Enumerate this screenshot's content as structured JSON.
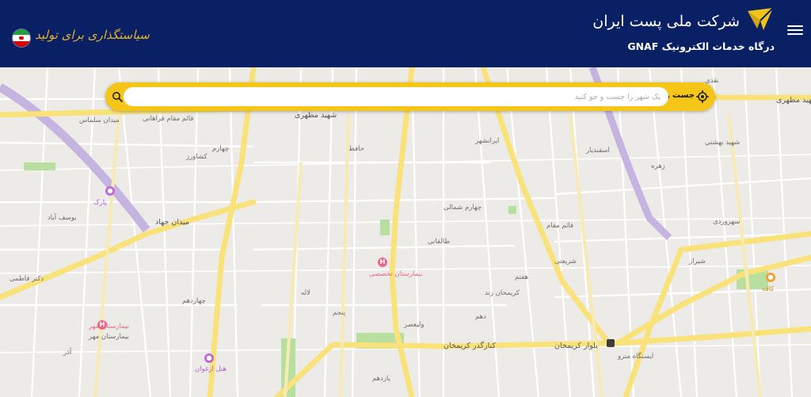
{
  "header": {
    "company_name": "شرکت ملی پست ایران",
    "portal_title": "درگاه خدمات الکترونیک GNAF",
    "slogan": "سیاستگذاری برای تولید",
    "colors": {
      "background": "#0a2064",
      "logo": "#f0c419",
      "slogan": "#e5b22e"
    }
  },
  "search": {
    "label": "جست و جوی کد پستی با پیمایش نقشه",
    "placeholder": "یک شهر را جست و جو کنید",
    "value": "",
    "accent": "#f5c518"
  },
  "map": {
    "street_labels": [
      "شهید مطهری",
      "میدان سلماس",
      "قائم مقام فراهانی",
      "شهید مطهری",
      "نقدی",
      "اسفندیار",
      "ایرانشهر",
      "زهره",
      "شریعتی",
      "دکتر فاطمی",
      "میدان جهاد",
      "بلوار کریمخان",
      "کنارگذر کریمخان",
      "شیراز",
      "بیمارستان مهر",
      "شهید بهشتی",
      "کشاورز",
      "لاله",
      "سهروردی",
      "ولیعصر",
      "طالقانی",
      "آذر",
      "حافظ",
      "کریمخان زند",
      "ایستگاه مترو",
      "یوسف آباد",
      "قائم مقام",
      "چهارم",
      "پنجم",
      "هفتم",
      "دهم",
      "یازدهم",
      "چهاردهم",
      "چهارم شمالی"
    ],
    "poi_labels": [
      "بیمارستان تخصصی",
      "هتل ارغوان",
      "پارک",
      "بیمارستان مهر",
      "کافه"
    ]
  }
}
